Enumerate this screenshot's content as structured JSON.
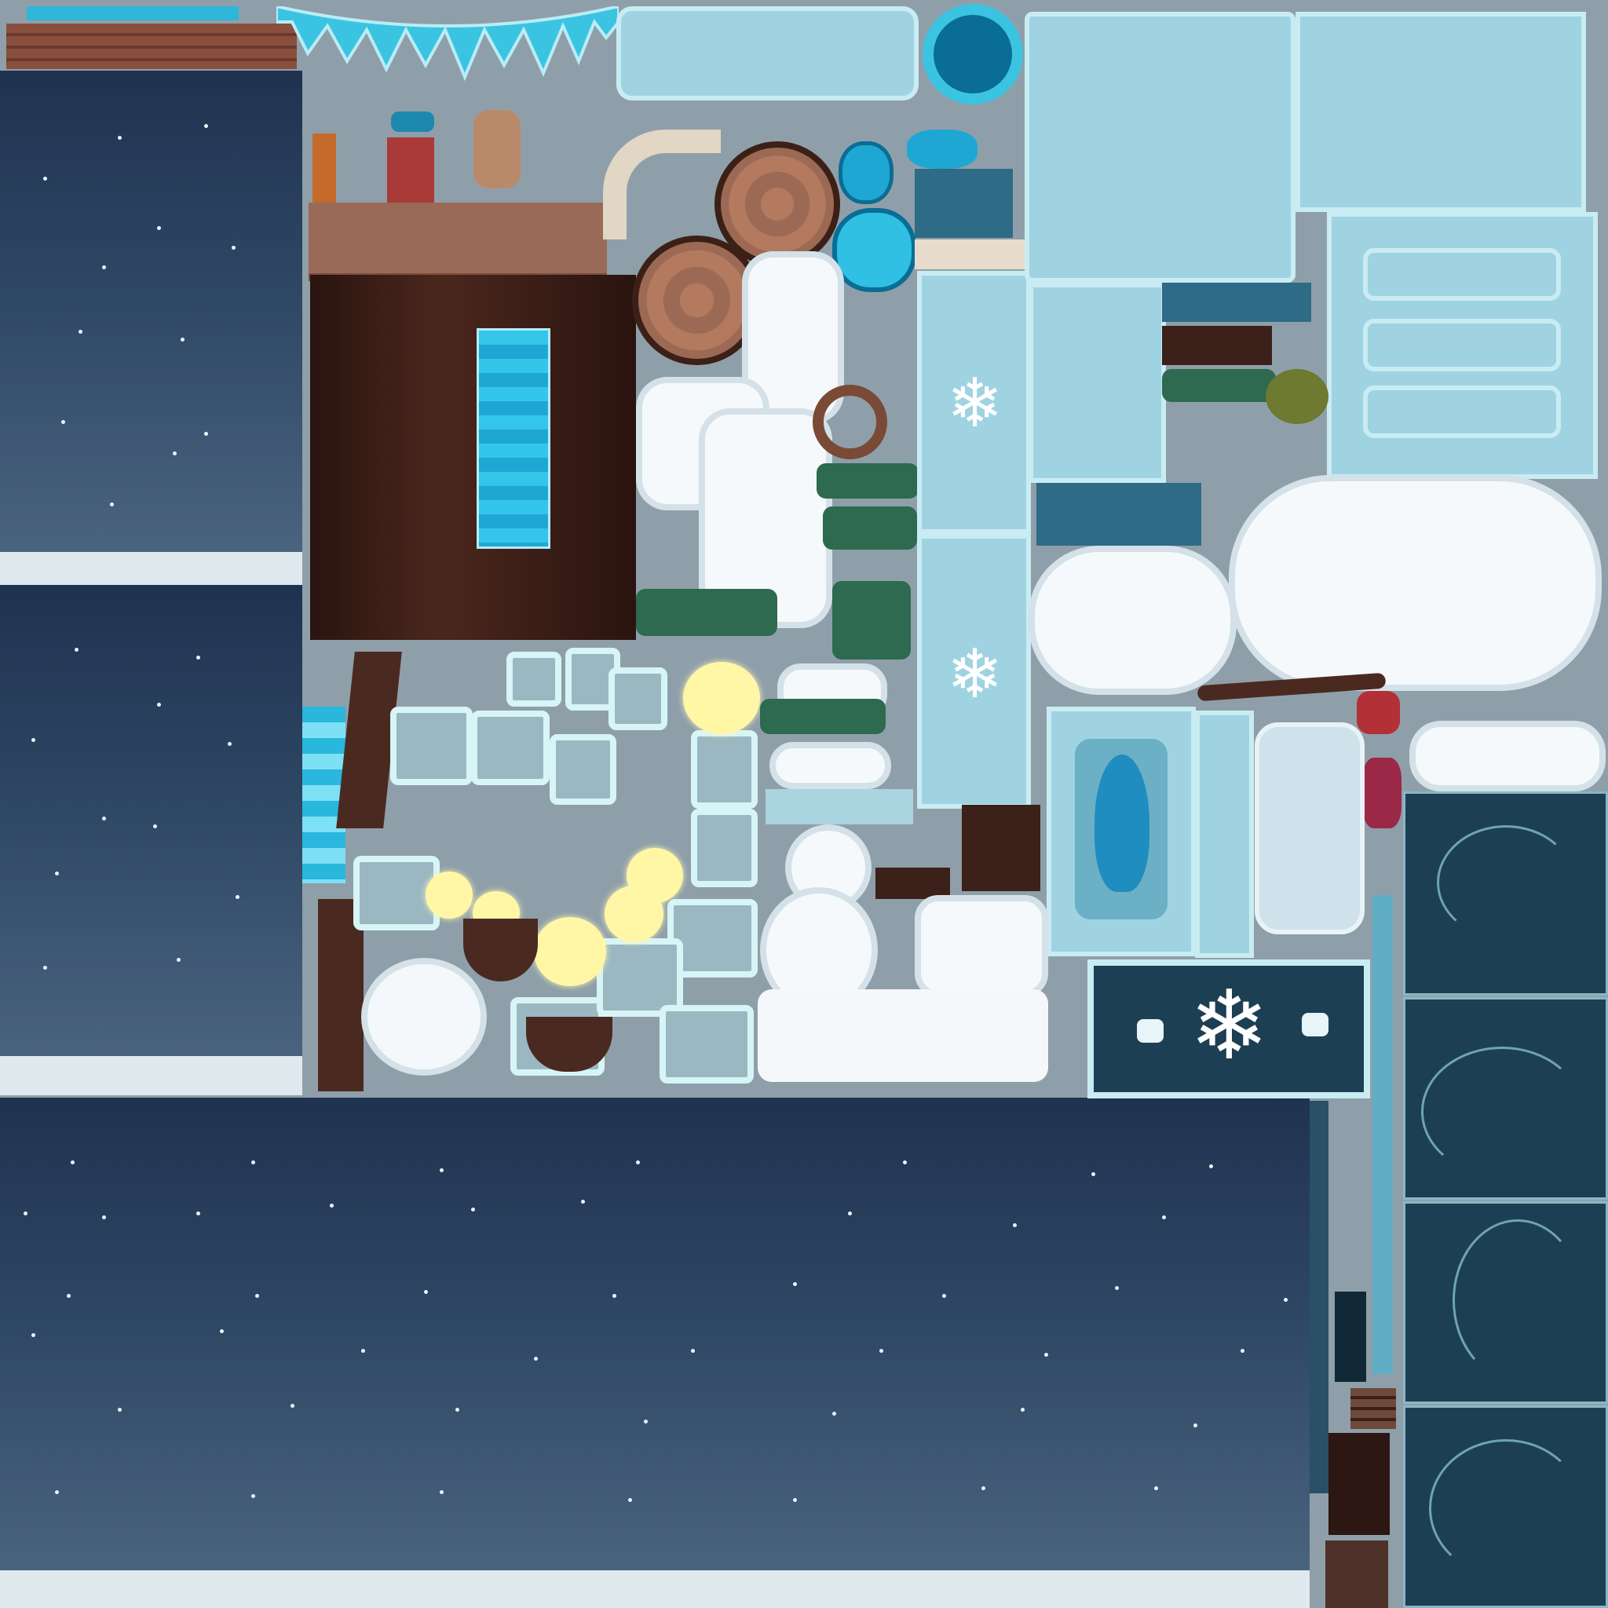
{
  "atlas": {
    "palette": {
      "night_top": "#1f3350",
      "night_bottom": "#4e6782",
      "ice_light": "#c9ecf3",
      "ice_mid": "#9fd3e2",
      "ice_deep": "#0a6d95",
      "snow": "#f6f9fb",
      "wood": "#7a4a36",
      "bark_dark": "#2c1712",
      "pine": "#2d6a4f",
      "lantern_glow": "#fff7a6",
      "gem_red": "#b23036",
      "panel_teal": "#1d3f53"
    },
    "icons": [
      "snowflake-icon",
      "star-icon",
      "icicle-icon",
      "gem-icon",
      "log-icon",
      "pine-tree-icon",
      "snowman-icon",
      "lantern-icon"
    ]
  }
}
